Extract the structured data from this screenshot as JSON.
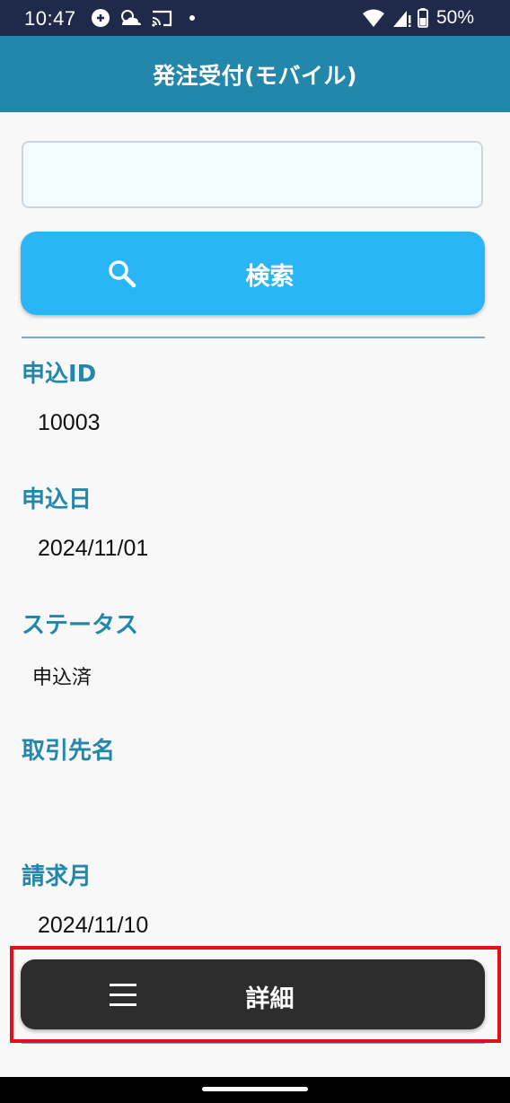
{
  "status_bar": {
    "time": "10:47",
    "battery": "50%"
  },
  "header": {
    "title": "発注受付(モバイル)"
  },
  "search": {
    "value": "",
    "placeholder": "",
    "button_label": "検索"
  },
  "fields": [
    {
      "label": "申込ID",
      "value": "10003"
    },
    {
      "label": "申込日",
      "value": "2024/11/01"
    },
    {
      "label": "ステータス",
      "value": "申込済"
    },
    {
      "label": "取引先名",
      "value": ""
    },
    {
      "label": "請求月",
      "value": "2024/11/10"
    }
  ],
  "detail_button": {
    "label": "詳細"
  },
  "colors": {
    "accent": "#2386ab",
    "search_button": "#29b6f6",
    "detail_button": "#2d2d2d",
    "highlight": "#e3101a"
  }
}
